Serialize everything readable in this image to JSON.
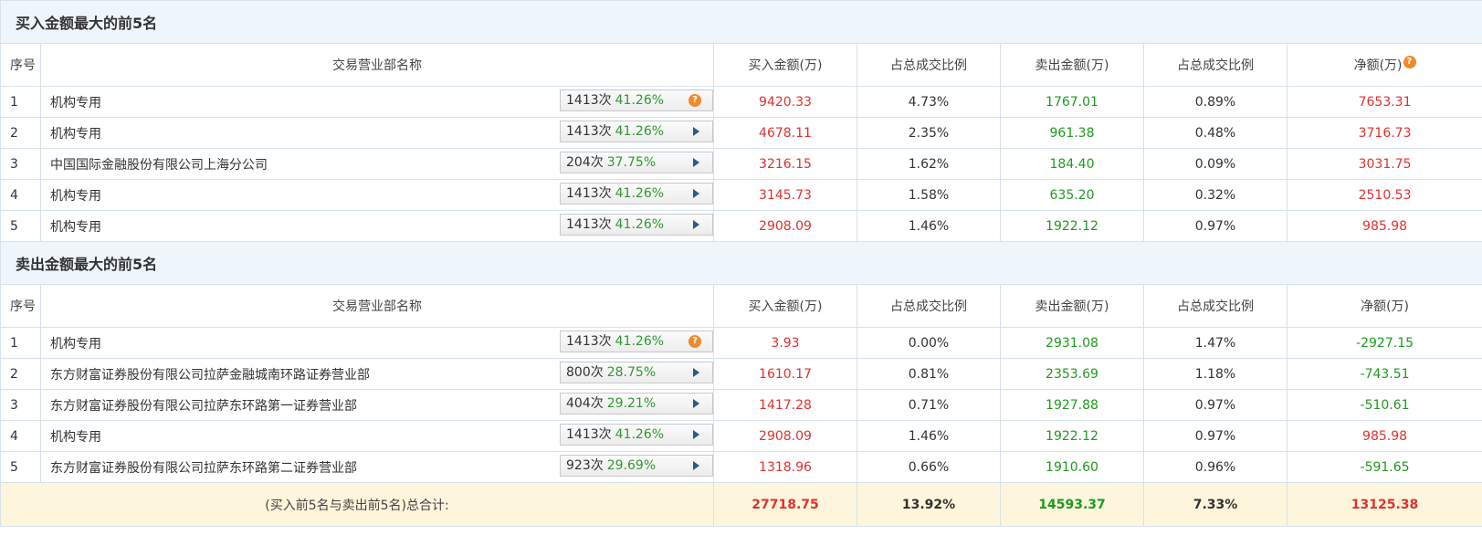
{
  "buy_section": {
    "title": "买入金额最大的前5名",
    "headers": [
      "序号",
      "交易营业部名称",
      "买入金额(万)",
      "占总成交比例",
      "卖出金额(万)",
      "占总成交比例",
      "净额(万)"
    ],
    "help_icon": "?",
    "rows": [
      {
        "idx": "1",
        "name": "机构专用",
        "cnt": "1413次",
        "pct": "41.26%",
        "icon": "?",
        "buy": "9420.33",
        "buy_ratio": "4.73%",
        "sell": "1767.01",
        "sell_ratio": "0.89%",
        "net": "7653.31"
      },
      {
        "idx": "2",
        "name": "机构专用",
        "cnt": "1413次",
        "pct": "41.26%",
        "icon": "play",
        "buy": "4678.11",
        "buy_ratio": "2.35%",
        "sell": "961.38",
        "sell_ratio": "0.48%",
        "net": "3716.73"
      },
      {
        "idx": "3",
        "name": "中国国际金融股份有限公司上海分公司",
        "cnt": "204次",
        "pct": "37.75%",
        "icon": "play",
        "buy": "3216.15",
        "buy_ratio": "1.62%",
        "sell": "184.40",
        "sell_ratio": "0.09%",
        "net": "3031.75"
      },
      {
        "idx": "4",
        "name": "机构专用",
        "cnt": "1413次",
        "pct": "41.26%",
        "icon": "play",
        "buy": "3145.73",
        "buy_ratio": "1.58%",
        "sell": "635.20",
        "sell_ratio": "0.32%",
        "net": "2510.53"
      },
      {
        "idx": "5",
        "name": "机构专用",
        "cnt": "1413次",
        "pct": "41.26%",
        "icon": "play",
        "buy": "2908.09",
        "buy_ratio": "1.46%",
        "sell": "1922.12",
        "sell_ratio": "0.97%",
        "net": "985.98"
      }
    ]
  },
  "sell_section": {
    "title": "卖出金额最大的前5名",
    "headers": [
      "序号",
      "交易营业部名称",
      "买入金额(万)",
      "占总成交比例",
      "卖出金额(万)",
      "占总成交比例",
      "净额(万)"
    ],
    "rows": [
      {
        "idx": "1",
        "name": "机构专用",
        "cnt": "1413次",
        "pct": "41.26%",
        "icon": "?",
        "buy": "3.93",
        "buy_ratio": "0.00%",
        "sell": "2931.08",
        "sell_ratio": "1.47%",
        "net": "-2927.15"
      },
      {
        "idx": "2",
        "name": "东方财富证券股份有限公司拉萨金融城南环路证券营业部",
        "cnt": "800次",
        "pct": "28.75%",
        "icon": "play",
        "buy": "1610.17",
        "buy_ratio": "0.81%",
        "sell": "2353.69",
        "sell_ratio": "1.18%",
        "net": "-743.51"
      },
      {
        "idx": "3",
        "name": "东方财富证券股份有限公司拉萨东环路第一证券营业部",
        "cnt": "404次",
        "pct": "29.21%",
        "icon": "play",
        "buy": "1417.28",
        "buy_ratio": "0.71%",
        "sell": "1927.88",
        "sell_ratio": "0.97%",
        "net": "-510.61"
      },
      {
        "idx": "4",
        "name": "机构专用",
        "cnt": "1413次",
        "pct": "41.26%",
        "icon": "play",
        "buy": "2908.09",
        "buy_ratio": "1.46%",
        "sell": "1922.12",
        "sell_ratio": "0.97%",
        "net": "985.98"
      },
      {
        "idx": "5",
        "name": "东方财富证券股份有限公司拉萨东环路第二证券营业部",
        "cnt": "923次",
        "pct": "29.69%",
        "icon": "play",
        "buy": "1318.96",
        "buy_ratio": "0.66%",
        "sell": "1910.60",
        "sell_ratio": "0.96%",
        "net": "-591.65"
      }
    ]
  },
  "total": {
    "label": "(买入前5名与卖出前5名)总合计:",
    "buy": "27718.75",
    "buy_ratio": "13.92%",
    "sell": "14593.37",
    "sell_ratio": "7.33%",
    "net": "13125.38"
  },
  "colors": {
    "red": "#e0312f",
    "green": "#1e9a1e",
    "header_bg": "#eef5fb",
    "total_bg": "#fdf6dd"
  }
}
